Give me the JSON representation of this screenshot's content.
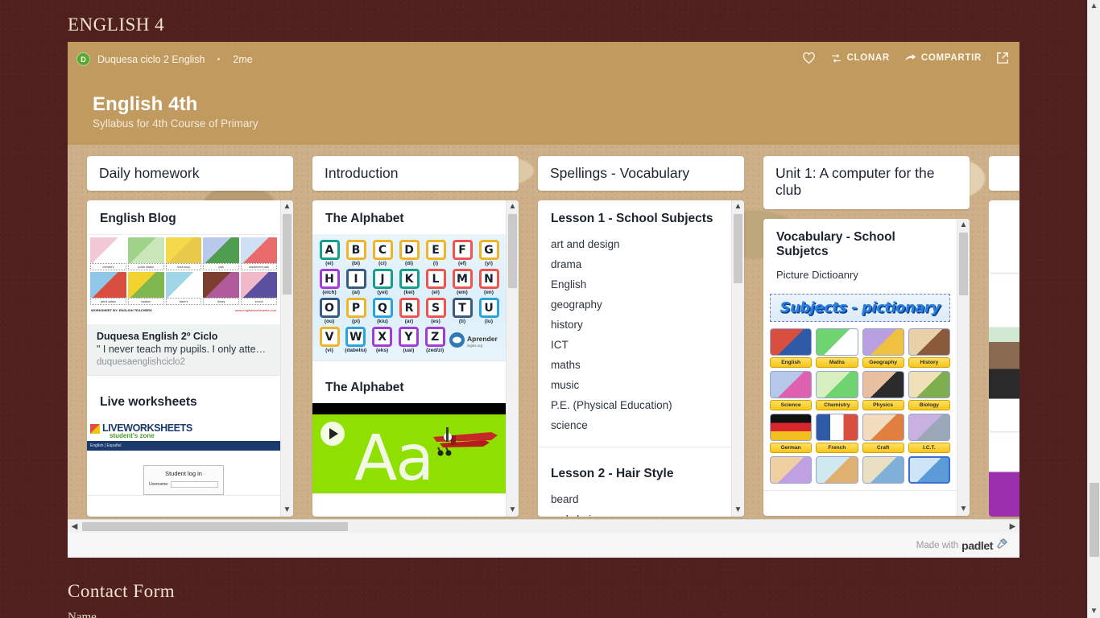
{
  "page": {
    "heading": "ENGLISH 4",
    "contact_heading": "Contact Form",
    "contact_first_field": "Name",
    "background_color": "#50201f",
    "accent_color": "#c09a5e"
  },
  "padlet": {
    "author": "Duquesa ciclo 2 English",
    "author_initial": "D",
    "timestamp": "2me",
    "title": "English 4th",
    "subtitle": "Syllabus for 4th Course of Primary",
    "actions": [
      {
        "name": "favorite",
        "label": "",
        "icon": "heart-icon"
      },
      {
        "name": "clone",
        "label": "CLONAR",
        "icon": "remix-icon"
      },
      {
        "name": "share",
        "label": "COMPARTIR",
        "icon": "share-arrow-icon"
      },
      {
        "name": "expand",
        "label": "",
        "icon": "external-link-icon"
      }
    ],
    "footer": {
      "made_with": "Made with",
      "brand": "padlet"
    }
  },
  "columns": [
    {
      "title": "Daily homework",
      "cards": [
        {
          "title": "English Blog",
          "type": "link-preview",
          "preview": {
            "title": "Duquesa English 2º Ciclo",
            "description": "\" I never teach my pupils. I only attempt t…",
            "link": "duquesaenglishciclo2"
          },
          "image": {
            "type": "places-pictionary",
            "footer_left": "WORKSHEET BY: ENGLISH TEACHERS",
            "footer_right": "www.englishworksheets.com",
            "cells": [
              {
                "label": "chemist's",
                "c1": "#f2c7d6",
                "c2": "#ffffff"
              },
              {
                "label": "police station",
                "c1": "#9fd38a",
                "c2": "#c8e6b8"
              },
              {
                "label": "book shop",
                "c1": "#f5d94a",
                "c2": "#e8c94a"
              },
              {
                "label": "park",
                "c1": "#b9c9ec",
                "c2": "#4f9d4f"
              },
              {
                "label": "amusement park",
                "c1": "#cfe0f5",
                "c2": "#e86a6a"
              },
              {
                "label": "petrol station",
                "c1": "#8ec7e8",
                "c2": "#d94f3f"
              },
              {
                "label": "stadium",
                "c1": "#f2d22e",
                "c2": "#7fb84f"
              },
              {
                "label": "baker's",
                "c1": "#9fd6e8",
                "c2": "#ffffff"
              },
              {
                "label": "library",
                "c1": "#7c3f2f",
                "c2": "#b05a9c"
              },
              {
                "label": "school",
                "c1": "#f0b8c8",
                "c2": "#5b4fa0"
              }
            ]
          }
        },
        {
          "title": "Live worksheets",
          "type": "web-screenshot",
          "site": {
            "brand": "LIVEWORKSHEETS",
            "tagline": "student's zone",
            "nav": "English  |  Español",
            "login_title": "Student log in",
            "login_field": "Username:"
          }
        }
      ]
    },
    {
      "title": "Introduction",
      "cards": [
        {
          "title": "The Alphabet",
          "type": "alphabet-chart",
          "credit_name": "Aprender",
          "credit_sub": "ingles.org",
          "letters": [
            {
              "letter": "A",
              "phonetic": "(ei)",
              "color": "#14a08a"
            },
            {
              "letter": "B",
              "phonetic": "(bi)",
              "color": "#f0b429"
            },
            {
              "letter": "C",
              "phonetic": "(ci)",
              "color": "#f0b429"
            },
            {
              "letter": "D",
              "phonetic": "(di)",
              "color": "#f0b429"
            },
            {
              "letter": "E",
              "phonetic": "(i)",
              "color": "#f0b429"
            },
            {
              "letter": "F",
              "phonetic": "(ef)",
              "color": "#ef5350"
            },
            {
              "letter": "G",
              "phonetic": "(yi)",
              "color": "#f0b429"
            },
            {
              "letter": "H",
              "phonetic": "(eich)",
              "color": "#a13cd6"
            },
            {
              "letter": "I",
              "phonetic": "(ai)",
              "color": "#3b5a80"
            },
            {
              "letter": "J",
              "phonetic": "(yei)",
              "color": "#14a08a"
            },
            {
              "letter": "K",
              "phonetic": "(kei)",
              "color": "#14a08a"
            },
            {
              "letter": "L",
              "phonetic": "(el)",
              "color": "#ef5350"
            },
            {
              "letter": "M",
              "phonetic": "(em)",
              "color": "#ef5350"
            },
            {
              "letter": "N",
              "phonetic": "(en)",
              "color": "#ef5350"
            },
            {
              "letter": "O",
              "phonetic": "(ou)",
              "color": "#3b5a80"
            },
            {
              "letter": "P",
              "phonetic": "(pi)",
              "color": "#f0b429"
            },
            {
              "letter": "Q",
              "phonetic": "(kiu)",
              "color": "#29a3dc"
            },
            {
              "letter": "R",
              "phonetic": "(ar)",
              "color": "#ef5350"
            },
            {
              "letter": "S",
              "phonetic": "(es)",
              "color": "#ef5350"
            },
            {
              "letter": "T",
              "phonetic": "(ti)",
              "color": "#3b5a80"
            },
            {
              "letter": "U",
              "phonetic": "(iu)",
              "color": "#29a3dc"
            },
            {
              "letter": "V",
              "phonetic": "(vi)",
              "color": "#f0b429"
            },
            {
              "letter": "W",
              "phonetic": "(dabeliu)",
              "color": "#29a3dc"
            },
            {
              "letter": "X",
              "phonetic": "(eks)",
              "color": "#a13cd6"
            },
            {
              "letter": "Y",
              "phonetic": "(uai)",
              "color": "#a13cd6"
            },
            {
              "letter": "Z",
              "phonetic": "(zed/zi)",
              "color": "#a13cd6"
            }
          ]
        },
        {
          "title": "The Alphabet",
          "type": "video",
          "video": {
            "screen_text": "Aa",
            "background_color": "#8fe000"
          }
        }
      ]
    },
    {
      "title": "Spellings - Vocabulary",
      "cards": [
        {
          "title": "Lesson 1 - School Subjects",
          "type": "word-list",
          "words": [
            "art and design",
            "drama",
            "English",
            "geography",
            "history",
            "ICT",
            "maths",
            "music",
            "P.E. (Physical Education)",
            "science"
          ]
        },
        {
          "title": "Lesson 2 - Hair Style",
          "type": "word-list",
          "words": [
            "beard",
            "curly hair"
          ]
        }
      ]
    },
    {
      "title": "Unit 1: A computer for the club",
      "cards": [
        {
          "title": "Vocabulary - School Subjetcs",
          "subtitle": "Picture Dictioanry",
          "type": "pictionary",
          "banner_text": "Subjects - pictionary",
          "items": [
            {
              "label": "English",
              "c1": "#d94f3f",
              "c2": "#2f5aa8"
            },
            {
              "label": "Maths",
              "c1": "#6fd46f",
              "c2": "#ffffff"
            },
            {
              "label": "Geography",
              "c1": "#b8a0e0",
              "c2": "#f0c040"
            },
            {
              "label": "History",
              "c1": "#e8d0a8",
              "c2": "#8a5a3a"
            },
            {
              "label": "Science",
              "c1": "#b6c8e8",
              "c2": "#e060b0"
            },
            {
              "label": "Chemistry",
              "c1": "#d8f0c0",
              "c2": "#6fd46f"
            },
            {
              "label": "Physics",
              "c1": "#e8c0a0",
              "c2": "#2b2b2b"
            },
            {
              "label": "Biology",
              "c1": "#f0e0b8",
              "c2": "#7fae4f"
            },
            {
              "label": "German",
              "c1": "#111111",
              "c2": "#f0c020"
            },
            {
              "label": "French",
              "c1": "#2f5aa8",
              "c2": "#d94f3f"
            },
            {
              "label": "Craft",
              "c1": "#f2dcc0",
              "c2": "#e07f3f"
            },
            {
              "label": "I.C.T.",
              "c1": "#c8b0e0",
              "c2": "#9aa8b8"
            }
          ]
        }
      ]
    }
  ]
}
